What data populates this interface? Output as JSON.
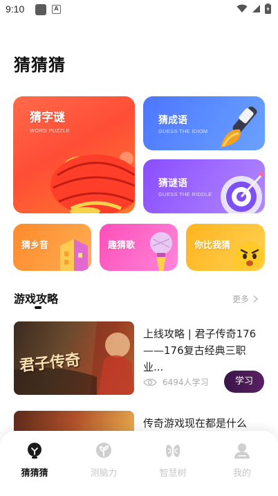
{
  "status": {
    "time": "9:10"
  },
  "page": {
    "title": "猜猜猜"
  },
  "games": {
    "word": {
      "title": "猜字谜",
      "sub": "WORD PUZZLE",
      "color": "#ff5038"
    },
    "idiom": {
      "title": "猜成语",
      "sub": "GUESS THE IDIOM",
      "color": "#5683ff"
    },
    "riddle": {
      "title": "猜谜语",
      "sub": "GUESS THE RIDDLE",
      "color": "#9d66ff"
    },
    "hometown": {
      "title": "猜乡音",
      "color": "#ff942f"
    },
    "song": {
      "title": "趣猜歌",
      "color": "#ff5dc4"
    },
    "charade": {
      "title": "你比我猜",
      "color": "#ffbf33"
    }
  },
  "section": {
    "title": "游戏攻略",
    "more": "更多"
  },
  "articles": [
    {
      "title": "上线攻略 | 君子传奇176——176复古经典三职业...",
      "views": "6494人学习",
      "button": "学习",
      "thumb_text": "君子传奇"
    },
    {
      "title": "传奇游戏现在都是什么"
    }
  ],
  "nav": [
    {
      "label": "猜猜猜",
      "icon": "lightbulb-icon",
      "active": true
    },
    {
      "label": "测脑力",
      "icon": "brain-sprout-icon",
      "active": false
    },
    {
      "label": "智慧树",
      "icon": "tree-icon",
      "active": false
    },
    {
      "label": "我的",
      "icon": "user-icon",
      "active": false
    }
  ],
  "colors": {
    "accent": "#3a1449",
    "inactive": "#c8c8c8"
  }
}
